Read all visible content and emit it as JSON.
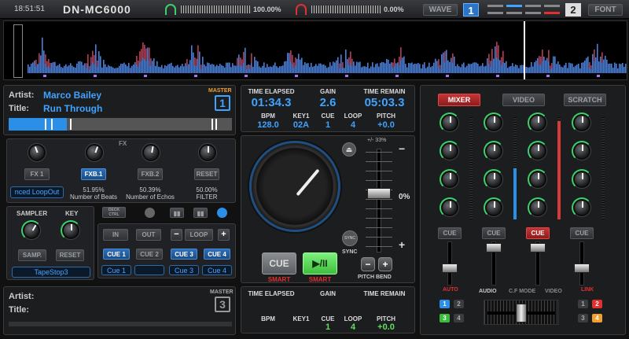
{
  "topbar": {
    "time": "18:51:51",
    "logo": "DN-MC6000",
    "vol_left": "100.00%",
    "vol_right": "0.00%",
    "wave_label": "WAVE",
    "deck_left": "1",
    "deck_right": "2",
    "font_label": "FONT"
  },
  "deck1": {
    "artist_label": "Artist:",
    "artist": "Marco Bailey",
    "title_label": "Title:",
    "title": "Run Through",
    "master_label": "MASTER",
    "deck_number": "1",
    "fx_title": "FX",
    "fx_buttons": [
      "FX 1",
      "FXB.1",
      "FXB.2",
      "RESET"
    ],
    "loop_slot": "nced LoopOut",
    "fx_params": [
      {
        "value": "51.95%",
        "name": "Number of Beats"
      },
      {
        "value": "50.39%",
        "name": "Number of Echos"
      },
      {
        "value": "50.00%",
        "name": "FILTER"
      }
    ],
    "sampler_label": "SAMPLER",
    "key_label": "KEY",
    "samp_button": "SAMP.",
    "reset_button": "RESET",
    "sampler_slot": "TapeStop3",
    "deck_ctrl_label": "DECK CTRL",
    "loop_in": "IN",
    "loop_out": "OUT",
    "loop_label": "LOOP",
    "cue_buttons": [
      "CUE 1",
      "CUE 2",
      "CUE 3",
      "CUE 4"
    ],
    "cue_slots": [
      "Cue 1",
      "",
      "Cue 3",
      "Cue 4"
    ]
  },
  "center": {
    "time_elapsed_label": "TIME ELAPSED",
    "gain_label": "GAIN",
    "time_remain_label": "TIME REMAIN",
    "time_elapsed": "01:34.3",
    "gain": "2.6",
    "time_remain": "05:03.3",
    "bpm_label": "BPM",
    "key_label": "KEY1",
    "cue_label": "CUE",
    "loop_label": "LOOP",
    "pitch_label": "PITCH",
    "bpm": "128.0",
    "key": "02A",
    "cue": "1",
    "loop": "4",
    "pitch": "+0.0",
    "pitch_range": "+/- 33%",
    "pitch_percent": "0%",
    "cue_button": "CUE",
    "play_button": "▶/II",
    "smart_left": "SMART",
    "smart_right": "SMART",
    "sync_label": "SYNC",
    "sync_button": "SYNC",
    "pitch_bend_label": "PITCH BEND",
    "minus": "−",
    "plus": "+"
  },
  "deck2_info": {
    "time_elapsed_label": "TIME ELAPSED",
    "gain_label": "GAIN",
    "time_remain_label": "TIME REMAIN",
    "bpm_label": "BPM",
    "key_label": "KEY1",
    "cue_label": "CUE",
    "loop_label": "LOOP",
    "pitch_label": "PITCH",
    "cue": "1",
    "loop": "4",
    "pitch": "+0.0"
  },
  "deck3": {
    "artist_label": "Artist:",
    "title_label": "Title:",
    "master_label": "MASTER",
    "deck_number": "3"
  },
  "mixer": {
    "tabs": [
      "MIXER",
      "VIDEO",
      "SCRATCH"
    ],
    "cue_buttons": [
      "CUE",
      "CUE",
      "CUE",
      "CUE"
    ],
    "auto_label": "AUTO",
    "audio_label": "AUDIO",
    "cf_label": "C.F MODE",
    "video_label": "VIDEO",
    "link_label": "LINK",
    "deck_nums_left": [
      "1",
      "2",
      "3",
      "4"
    ],
    "deck_nums_right": [
      "1",
      "2",
      "3",
      "4"
    ]
  },
  "colors": {
    "accent_blue": "#3fa3ff",
    "accent_green": "#5de05d",
    "accent_red": "#e03030",
    "master_orange": "#f0a030"
  }
}
